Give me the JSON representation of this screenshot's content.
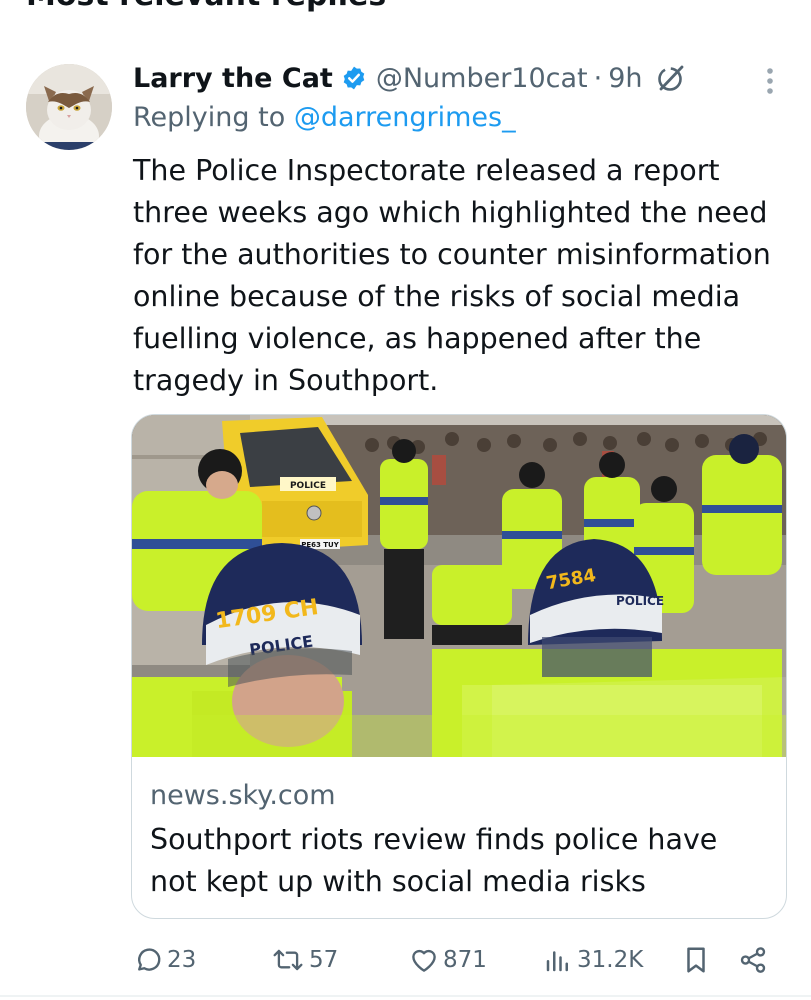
{
  "section": {
    "header": "Most relevant replies"
  },
  "tweet": {
    "display_name": "Larry the Cat",
    "handle": "@Number10cat",
    "separator": "·",
    "time": "9h",
    "reply_prefix": "Replying to ",
    "reply_to": "@darrengrimes_",
    "lines": [
      "The Police Inspectorate released a report",
      "three weeks ago which highlighted the need",
      "for the authorities to counter misinformation",
      "online because of the risks of social media",
      "fuelling violence, as happened after the",
      "tragedy in Southport."
    ]
  },
  "card": {
    "image_alt": "Police officers in riot gear and high-visibility jackets with a crowd behind",
    "image_texts": {
      "van_label": "POLICE",
      "plate": "PE63 TUY",
      "helmet_left": "POLICE",
      "helmet_left_number": "1709 CH",
      "helmet_right": "POLICE",
      "helmet_right_number": "7584"
    },
    "domain": "news.sky.com",
    "title_lines": [
      "Southport riots review finds police have",
      "not kept up with social media risks"
    ]
  },
  "actions": {
    "replies": "23",
    "reposts": "57",
    "likes": "871",
    "views": "31.2K"
  },
  "colors": {
    "accent": "#1d9bf0",
    "text_primary": "#0f1419",
    "text_secondary": "#536471",
    "border": "#cfd9de",
    "hi_vis": "#c9f02a"
  },
  "icons": {
    "verified": "verified-badge-icon",
    "grok": "grok-icon",
    "more": "more-dots-icon",
    "reply": "reply-bubble-icon",
    "repost": "repost-icon",
    "like": "heart-icon",
    "views": "analytics-bars-icon",
    "bookmark": "bookmark-icon",
    "share": "share-icon"
  }
}
